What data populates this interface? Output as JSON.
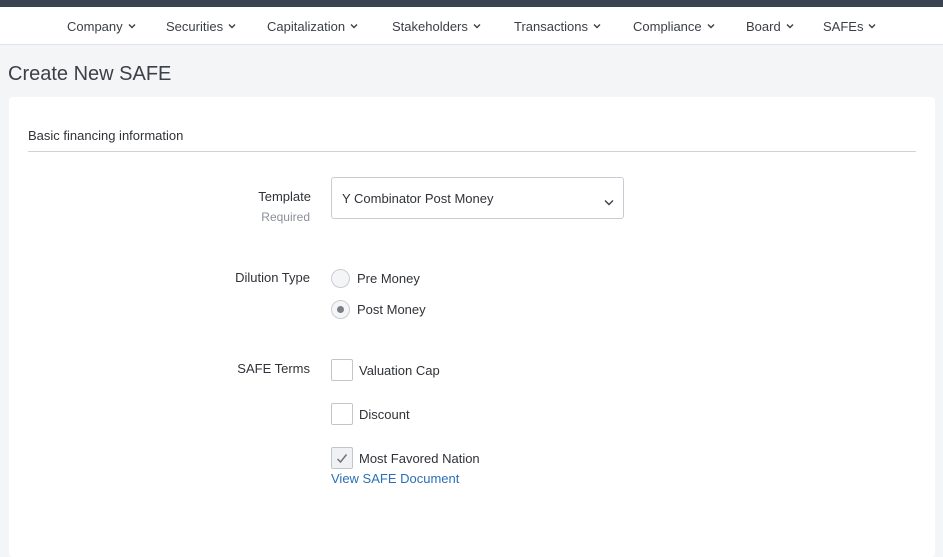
{
  "nav": {
    "items": [
      {
        "label": "Company"
      },
      {
        "label": "Securities"
      },
      {
        "label": "Capitalization"
      },
      {
        "label": "Stakeholders"
      },
      {
        "label": "Transactions"
      },
      {
        "label": "Compliance"
      },
      {
        "label": "Board"
      },
      {
        "label": "SAFEs"
      }
    ]
  },
  "page": {
    "title": "Create New SAFE"
  },
  "form": {
    "section_title": "Basic financing information",
    "template": {
      "label": "Template",
      "sublabel": "Required",
      "value": "Y Combinator Post Money"
    },
    "dilution": {
      "label": "Dilution Type",
      "options": [
        {
          "label": "Pre Money",
          "selected": false
        },
        {
          "label": "Post Money",
          "selected": true
        }
      ]
    },
    "terms": {
      "label": "SAFE Terms",
      "options": [
        {
          "label": "Valuation Cap",
          "checked": false
        },
        {
          "label": "Discount",
          "checked": false
        },
        {
          "label": "Most Favored Nation",
          "checked": true
        }
      ]
    },
    "view_document_link": "View SAFE Document"
  },
  "icons": {
    "nav_chevron": "chevron-down-icon",
    "select_chevron": "chevron-down-icon",
    "check": "check-icon"
  },
  "colors": {
    "topbar": "#3a4450",
    "link": "#2a6fb5",
    "background": "#f4f5f7"
  }
}
